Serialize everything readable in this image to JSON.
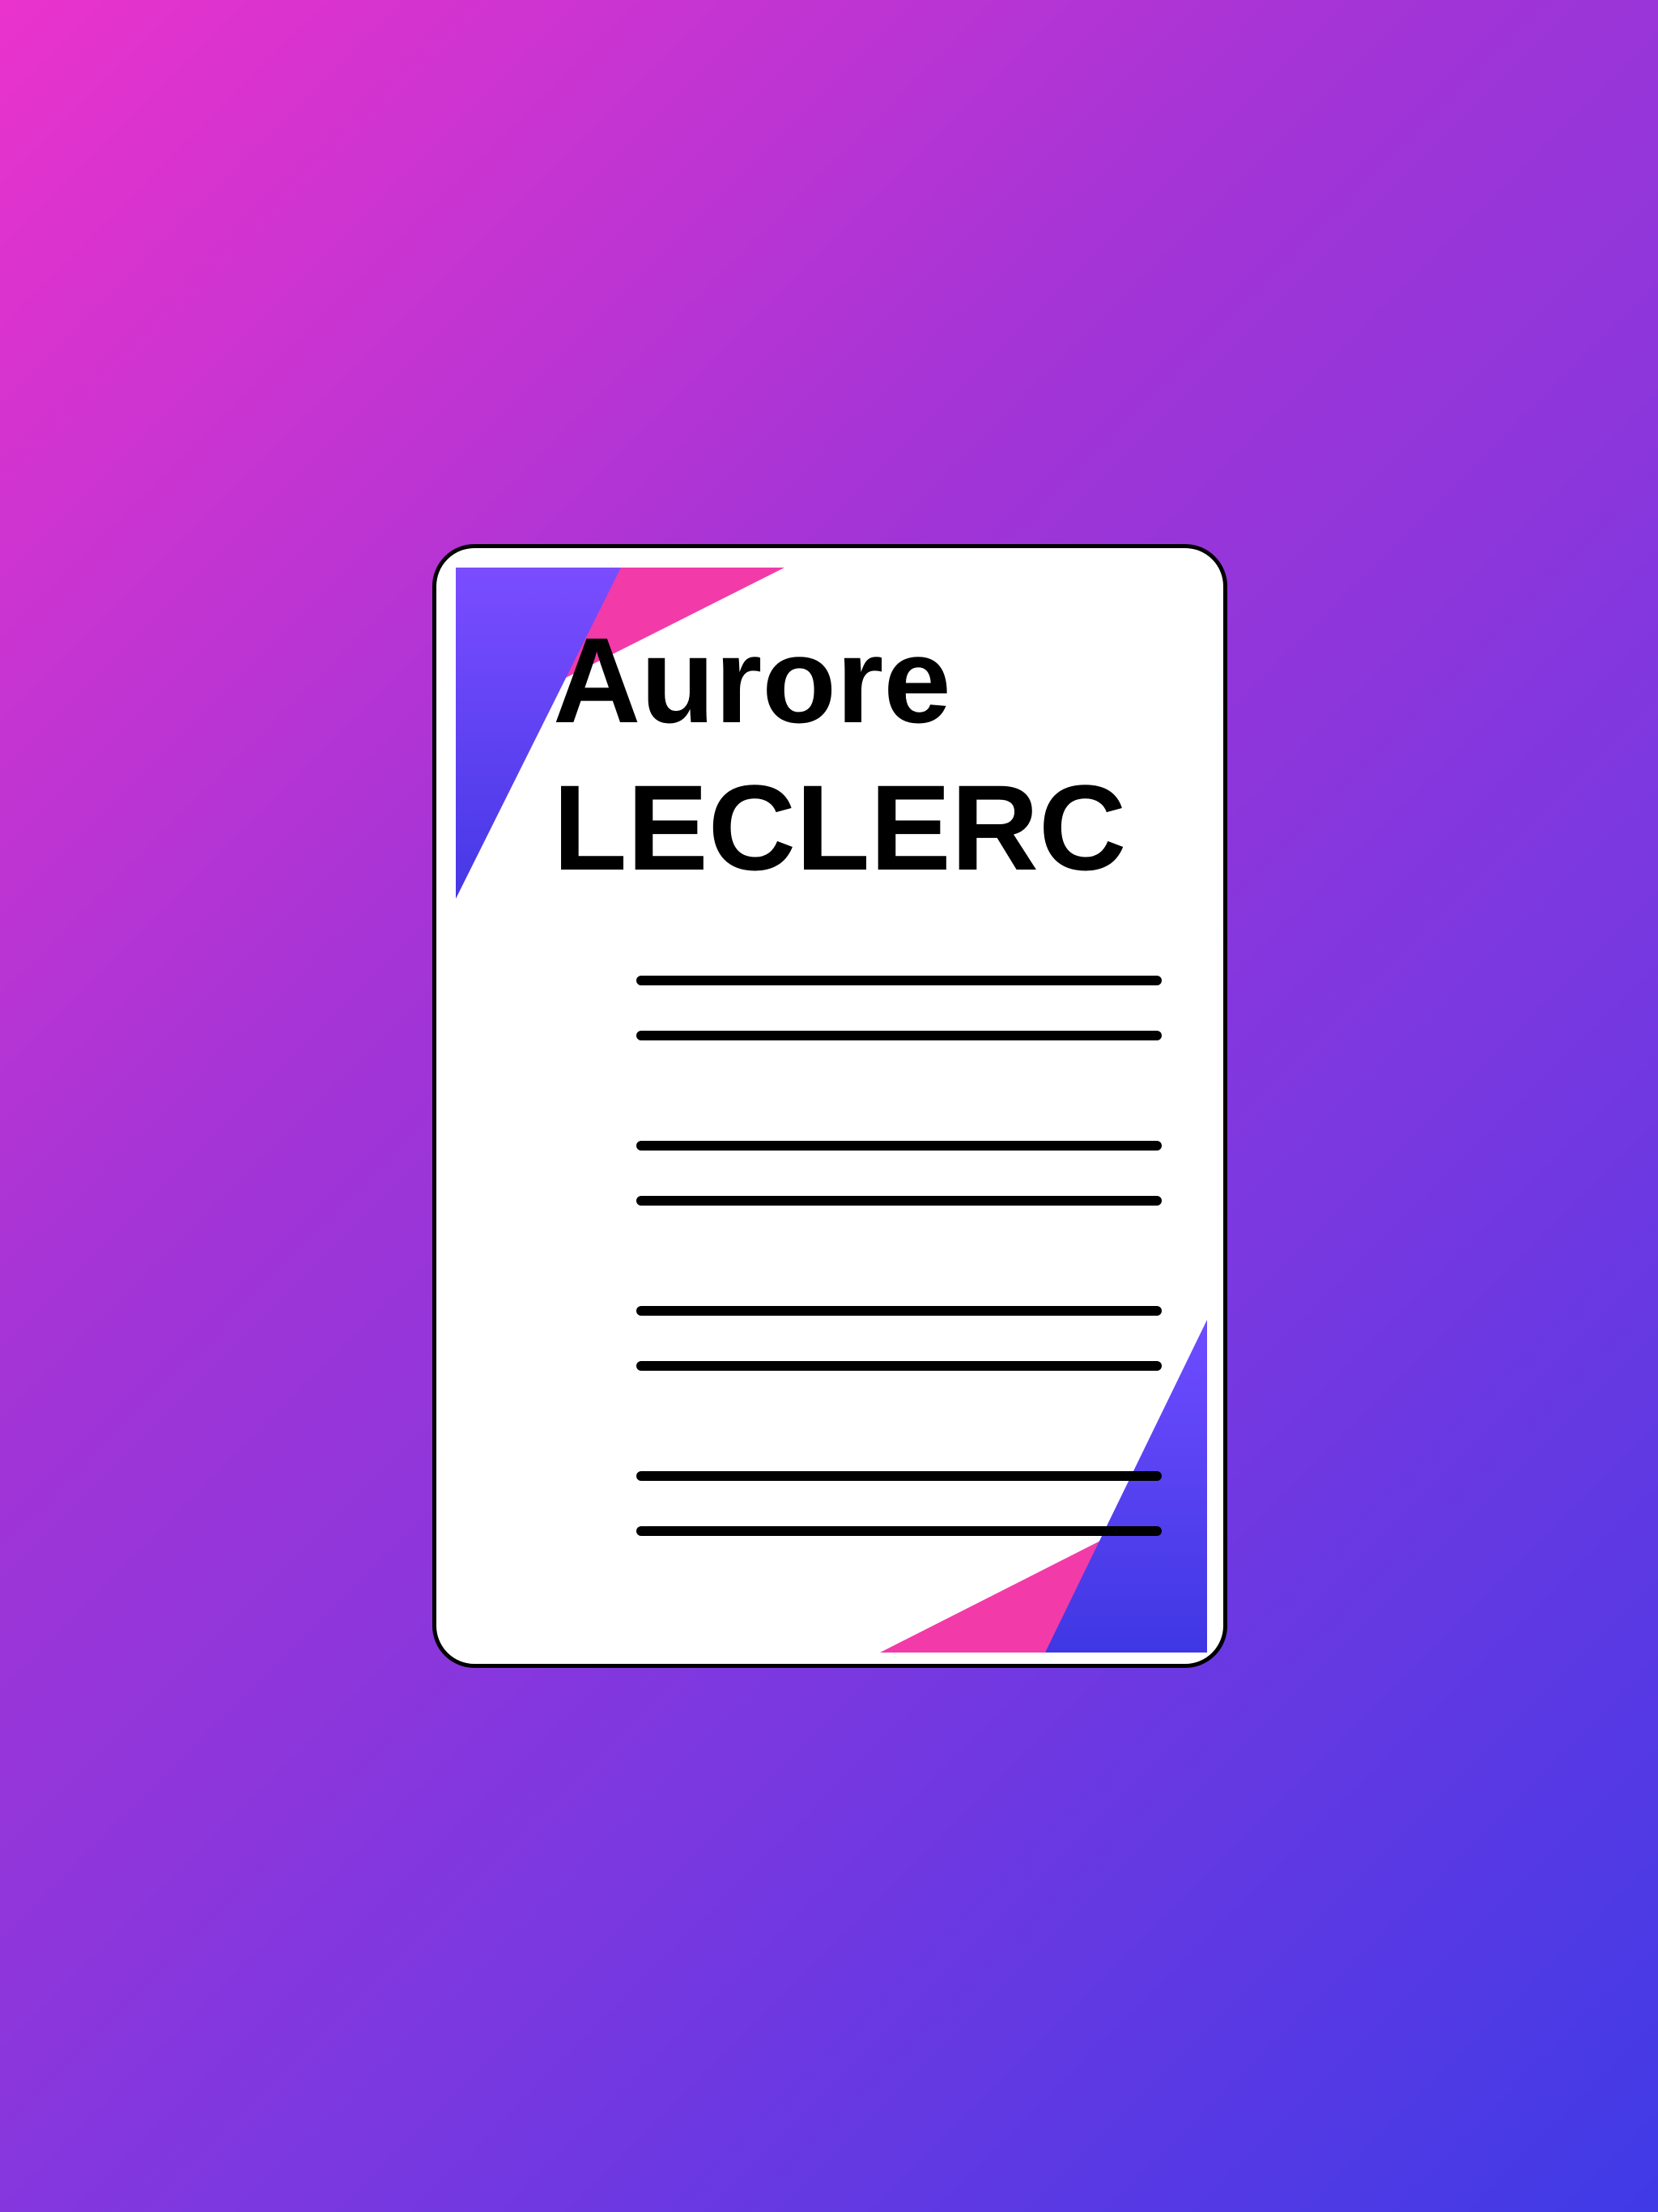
{
  "document": {
    "first_name": "Aurore",
    "last_name": "LECLERC"
  },
  "colors": {
    "background_start": "#ea33cc",
    "background_end": "#3f3ae6",
    "corner_violet": "#7a4dff",
    "corner_blue": "#4638e6",
    "corner_pink": "#f23aa8",
    "sections": [
      "#f39315",
      "#3ec93a",
      "#2196f3",
      "#e8403c"
    ],
    "text_line": "#000000"
  },
  "sections": [
    {
      "color_name": "orange",
      "lines": 2
    },
    {
      "color_name": "green",
      "lines": 2
    },
    {
      "color_name": "blue",
      "lines": 2
    },
    {
      "color_name": "red",
      "lines": 2
    }
  ],
  "icon": "resume-document-icon"
}
